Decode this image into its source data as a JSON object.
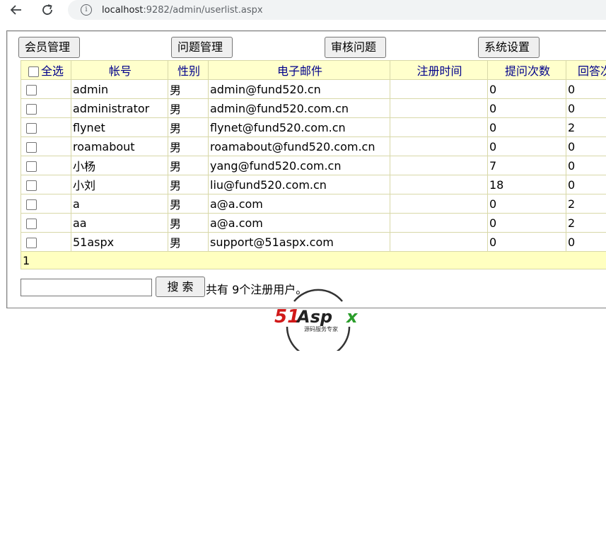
{
  "browser": {
    "url_host": "localhost",
    "url_rest": ":9282/admin/userlist.aspx"
  },
  "menu": [
    "会员管理",
    "问题管理",
    "审核问题",
    "系统设置"
  ],
  "table": {
    "select_all_label": "全选",
    "headers": [
      "帐号",
      "性别",
      "电子邮件",
      "注册时间",
      "提问次数",
      "回答次"
    ],
    "rows": [
      [
        "admin",
        "男",
        "admin@fund520.cn",
        "",
        "0",
        "0"
      ],
      [
        "administrator",
        "男",
        "admin@fund520.com.cn",
        "",
        "0",
        "0"
      ],
      [
        "flynet",
        "男",
        "flynet@fund520.com.cn",
        "",
        "0",
        "2"
      ],
      [
        "roamabout",
        "男",
        "roamabout@fund520.com.cn",
        "",
        "0",
        "0"
      ],
      [
        "小杨",
        "男",
        "yang@fund520.com.cn",
        "",
        "7",
        "0"
      ],
      [
        "小刘",
        "男",
        "liu@fund520.com.cn",
        "",
        "18",
        "0"
      ],
      [
        "a",
        "男",
        "a@a.com",
        "",
        "0",
        "2"
      ],
      [
        "aa",
        "男",
        "a@a.com",
        "",
        "0",
        "2"
      ],
      [
        "51aspx",
        "男",
        "support@51aspx.com",
        "",
        "0",
        "0"
      ]
    ],
    "pager": "1"
  },
  "search": {
    "value": "",
    "button_label": "搜 索",
    "count_text": "共有 9个注册用户。"
  },
  "watermark": {
    "brand_51": "51",
    "brand_as": "Asp",
    "brand_x": "x",
    "slogan": "源码服务专家"
  }
}
